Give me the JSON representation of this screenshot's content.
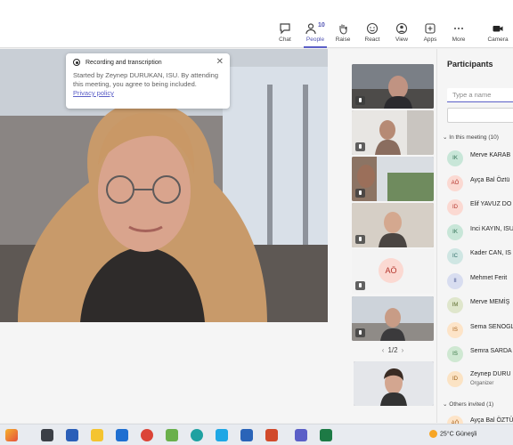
{
  "toolbar": {
    "buttons": [
      {
        "label": "Chat",
        "icon": "chat-icon"
      },
      {
        "label": "People",
        "icon": "people-icon",
        "count": "10"
      },
      {
        "label": "Raise",
        "icon": "raise-hand-icon"
      },
      {
        "label": "React",
        "icon": "smile-icon"
      },
      {
        "label": "View",
        "icon": "view-icon"
      },
      {
        "label": "Apps",
        "icon": "apps-icon"
      },
      {
        "label": "More",
        "icon": "more-icon"
      },
      {
        "label": "Camera",
        "icon": "camera-icon"
      }
    ]
  },
  "recording": {
    "title": "Recording and transcription",
    "text": "Started by Zeynep DURUKAN, ISU. By attending this meeting, you agree to being included.",
    "link": "Privacy policy"
  },
  "gallery": {
    "avatar_initials": "AÖ",
    "page": "1/2"
  },
  "participants": {
    "title": "Participants",
    "search_placeholder": "Type a name",
    "in_meeting_label": "In this meeting (10)",
    "others_label": "Others invited (1)",
    "list": [
      {
        "initials": "IK",
        "name": "Merve KARAB",
        "bg": "#c8e6d8",
        "fg": "#2d6e52"
      },
      {
        "initials": "AÖ",
        "name": "Ayça Bal Öztü",
        "bg": "#fbd9d2",
        "fg": "#b4342b"
      },
      {
        "initials": "ID",
        "name": "Elif YAVUZ DO",
        "bg": "#fbd9d2",
        "fg": "#b4342b"
      },
      {
        "initials": "IK",
        "name": "Inci KAYIN, ISU",
        "bg": "#c8e6d8",
        "fg": "#2d6e52"
      },
      {
        "initials": "IC",
        "name": "Kader CAN, IS",
        "bg": "#cfe6e3",
        "fg": "#2f6e68"
      },
      {
        "initials": "II",
        "name": "Mehmet Ferit",
        "bg": "#d8ddf0",
        "fg": "#3e4d8a"
      },
      {
        "initials": "IM",
        "name": "Merve MEMİŞ",
        "bg": "#dfe6cc",
        "fg": "#5b6b2c"
      },
      {
        "initials": "IS",
        "name": "Sema SENOGL",
        "bg": "#fde4c8",
        "fg": "#a35a12"
      },
      {
        "initials": "IS",
        "name": "Semra SARDA",
        "bg": "#cfe8d2",
        "fg": "#2e6e3a"
      },
      {
        "initials": "ID",
        "name": "Zeynep DURU",
        "sub": "Organizer",
        "bg": "#fbe3c4",
        "fg": "#9a5b12"
      }
    ],
    "invited": [
      {
        "initials": "AÖ",
        "name": "Ayça Bal ÖZTÜ",
        "bg": "#fde4c8",
        "fg": "#a35a12"
      }
    ]
  },
  "taskbar": {
    "weather": "25°C  Güneşli"
  }
}
